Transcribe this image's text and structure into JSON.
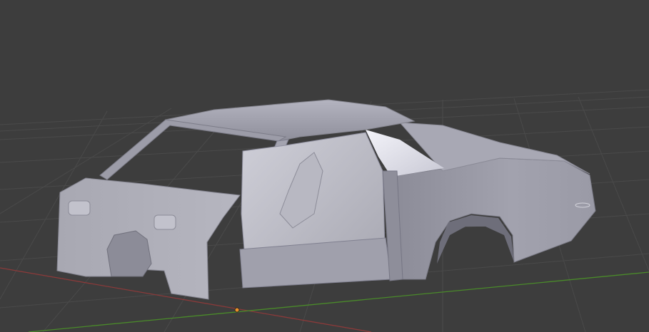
{
  "viewport": {
    "view": "3D Viewport",
    "background_color": "#3d3d3d",
    "grid_color": "#4a4a4a",
    "x_axis_color": "#8a3a3a",
    "y_axis_color": "#4a8a2a",
    "origin_color": "#e8902a"
  },
  "object": {
    "description": "car-body-shell-mesh",
    "base_color": "#a4a4b0",
    "highlight_color": "#d8d8e2",
    "shadow_color": "#7a7a86"
  }
}
